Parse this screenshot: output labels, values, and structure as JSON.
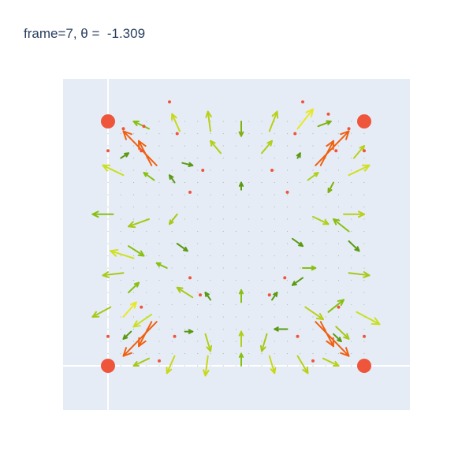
{
  "chart_data": {
    "type": "scatter",
    "title": "frame=7, θ =  -1.309",
    "xlabel": "",
    "ylabel": "",
    "xlim": [
      -0.2,
      1.3
    ],
    "ylim": [
      -0.2,
      1.3
    ],
    "grid": false,
    "zero_lines": true,
    "plot_bgcolor": "#E5ECF6",
    "colors": {
      "marker": "#EF553B",
      "title": "#2a3f5f"
    },
    "corner_markers": [
      {
        "x": 0,
        "y": 0
      },
      {
        "x": 1,
        "y": 0
      },
      {
        "x": 0,
        "y": 1
      },
      {
        "x": 1,
        "y": 1
      }
    ],
    "small_markers": [
      {
        "x": 0.24,
        "y": 1.08
      },
      {
        "x": 0.76,
        "y": 1.08
      },
      {
        "x": 0.27,
        "y": 0.95
      },
      {
        "x": 0.73,
        "y": 0.95
      },
      {
        "x": 0.13,
        "y": 0.88
      },
      {
        "x": 0.89,
        "y": 0.88
      },
      {
        "x": 0.37,
        "y": 0.8
      },
      {
        "x": 0.64,
        "y": 0.8
      },
      {
        "x": 0.32,
        "y": 0.71
      },
      {
        "x": 0.7,
        "y": 0.71
      },
      {
        "x": 0.32,
        "y": 0.36
      },
      {
        "x": 0.69,
        "y": 0.36
      },
      {
        "x": 0.36,
        "y": 0.29
      },
      {
        "x": 0.63,
        "y": 0.29
      },
      {
        "x": 0.13,
        "y": 0.24
      },
      {
        "x": 0.9,
        "y": 0.24
      },
      {
        "x": 0.26,
        "y": 0.12
      },
      {
        "x": 0.74,
        "y": 0.12
      },
      {
        "x": 0.0,
        "y": 0.12
      },
      {
        "x": 1.0,
        "y": 0.12
      },
      {
        "x": 0.0,
        "y": 0.88
      },
      {
        "x": 1.0,
        "y": 0.88
      },
      {
        "x": 0.06,
        "y": 0.97
      },
      {
        "x": 0.94,
        "y": 0.97
      },
      {
        "x": 0.2,
        "y": 0.02
      },
      {
        "x": 0.8,
        "y": 0.02
      },
      {
        "x": 0.14,
        "y": 0.98
      },
      {
        "x": 0.86,
        "y": 1.03
      }
    ],
    "arrows": [
      {
        "x": 0.19,
        "y": 0.82,
        "u": -0.13,
        "v": 0.14,
        "color": "#f06010"
      },
      {
        "x": 0.81,
        "y": 0.82,
        "u": 0.13,
        "v": 0.14,
        "color": "#f06010"
      },
      {
        "x": 0.19,
        "y": 0.18,
        "u": -0.13,
        "v": -0.14,
        "color": "#f06010"
      },
      {
        "x": 0.81,
        "y": 0.18,
        "u": 0.13,
        "v": -0.14,
        "color": "#f06010"
      },
      {
        "x": 0.17,
        "y": 0.82,
        "u": -0.05,
        "v": 0.1,
        "color": "#f06010"
      },
      {
        "x": 0.83,
        "y": 0.82,
        "u": 0.05,
        "v": 0.1,
        "color": "#f06010"
      },
      {
        "x": 0.17,
        "y": 0.18,
        "u": -0.05,
        "v": -0.1,
        "color": "#f06010"
      },
      {
        "x": 0.83,
        "y": 0.18,
        "u": 0.05,
        "v": -0.1,
        "color": "#f06010"
      },
      {
        "x": 0.16,
        "y": 0.97,
        "u": -0.06,
        "v": 0.03,
        "color": "#88c010"
      },
      {
        "x": 0.28,
        "y": 0.96,
        "u": -0.03,
        "v": 0.07,
        "color": "#c8d818"
      },
      {
        "x": 0.4,
        "y": 0.96,
        "u": -0.01,
        "v": 0.08,
        "color": "#b8d018"
      },
      {
        "x": 0.52,
        "y": 1.0,
        "u": 0.0,
        "v": -0.06,
        "color": "#80b010"
      },
      {
        "x": 0.63,
        "y": 0.96,
        "u": 0.03,
        "v": 0.08,
        "color": "#b8d018"
      },
      {
        "x": 0.74,
        "y": 0.97,
        "u": 0.06,
        "v": 0.08,
        "color": "#e8e820"
      },
      {
        "x": 0.82,
        "y": 0.98,
        "u": 0.05,
        "v": 0.02,
        "color": "#80b010"
      },
      {
        "x": 0.05,
        "y": 0.85,
        "u": 0.03,
        "v": 0.02,
        "color": "#5a9a10"
      },
      {
        "x": 0.29,
        "y": 0.83,
        "u": 0.04,
        "v": -0.01,
        "color": "#5a9a10"
      },
      {
        "x": 0.44,
        "y": 0.87,
        "u": -0.04,
        "v": 0.05,
        "color": "#b0d018"
      },
      {
        "x": 0.6,
        "y": 0.87,
        "u": 0.04,
        "v": 0.05,
        "color": "#b0d018"
      },
      {
        "x": 0.74,
        "y": 0.85,
        "u": 0.01,
        "v": 0.02,
        "color": "#5a9a10"
      },
      {
        "x": 0.96,
        "y": 0.85,
        "u": 0.04,
        "v": 0.05,
        "color": "#b8d018"
      },
      {
        "x": 0.06,
        "y": 0.78,
        "u": -0.08,
        "v": 0.04,
        "color": "#c8e020"
      },
      {
        "x": 0.18,
        "y": 0.76,
        "u": -0.04,
        "v": 0.03,
        "color": "#88c010"
      },
      {
        "x": 0.26,
        "y": 0.75,
        "u": -0.02,
        "v": 0.03,
        "color": "#5a9a10"
      },
      {
        "x": 0.52,
        "y": 0.72,
        "u": 0.0,
        "v": 0.03,
        "color": "#5a9a10"
      },
      {
        "x": 0.88,
        "y": 0.75,
        "u": -0.02,
        "v": -0.04,
        "color": "#80b010"
      },
      {
        "x": 0.78,
        "y": 0.76,
        "u": 0.04,
        "v": 0.03,
        "color": "#b0d018"
      },
      {
        "x": 0.94,
        "y": 0.78,
        "u": 0.08,
        "v": 0.04,
        "color": "#d0e020"
      },
      {
        "x": 0.02,
        "y": 0.62,
        "u": -0.08,
        "v": 0.0,
        "color": "#88c010"
      },
      {
        "x": 0.16,
        "y": 0.6,
        "u": -0.08,
        "v": -0.03,
        "color": "#a8c818"
      },
      {
        "x": 0.27,
        "y": 0.62,
        "u": -0.03,
        "v": -0.04,
        "color": "#a8c818"
      },
      {
        "x": 0.8,
        "y": 0.61,
        "u": 0.06,
        "v": -0.03,
        "color": "#b0d018"
      },
      {
        "x": 0.92,
        "y": 0.62,
        "u": 0.08,
        "v": 0.0,
        "color": "#b8d018"
      },
      {
        "x": 0.94,
        "y": 0.55,
        "u": -0.06,
        "v": 0.05,
        "color": "#88c010"
      },
      {
        "x": 0.08,
        "y": 0.49,
        "u": 0.06,
        "v": -0.04,
        "color": "#88c010"
      },
      {
        "x": 0.27,
        "y": 0.5,
        "u": 0.04,
        "v": -0.03,
        "color": "#5a9a10"
      },
      {
        "x": 0.72,
        "y": 0.52,
        "u": 0.04,
        "v": -0.03,
        "color": "#5a9a10"
      },
      {
        "x": 0.94,
        "y": 0.51,
        "u": 0.04,
        "v": -0.04,
        "color": "#5a9a10"
      },
      {
        "x": 0.1,
        "y": 0.44,
        "u": -0.09,
        "v": 0.03,
        "color": "#d0e020"
      },
      {
        "x": 0.23,
        "y": 0.4,
        "u": -0.04,
        "v": 0.02,
        "color": "#88c010"
      },
      {
        "x": 0.06,
        "y": 0.38,
        "u": -0.08,
        "v": -0.01,
        "color": "#a8c818"
      },
      {
        "x": 0.76,
        "y": 0.4,
        "u": 0.05,
        "v": 0.0,
        "color": "#88c010"
      },
      {
        "x": 0.94,
        "y": 0.38,
        "u": 0.08,
        "v": -0.01,
        "color": "#a8c818"
      },
      {
        "x": 0.76,
        "y": 0.36,
        "u": -0.04,
        "v": -0.03,
        "color": "#5a9a10"
      },
      {
        "x": 0.01,
        "y": 0.24,
        "u": -0.07,
        "v": -0.04,
        "color": "#a8c818"
      },
      {
        "x": 0.08,
        "y": 0.3,
        "u": 0.04,
        "v": 0.04,
        "color": "#88c010"
      },
      {
        "x": 0.17,
        "y": 0.21,
        "u": -0.07,
        "v": -0.05,
        "color": "#c8e020"
      },
      {
        "x": 0.33,
        "y": 0.28,
        "u": -0.06,
        "v": 0.04,
        "color": "#a8c818"
      },
      {
        "x": 0.4,
        "y": 0.27,
        "u": -0.02,
        "v": 0.03,
        "color": "#5a9a10"
      },
      {
        "x": 0.52,
        "y": 0.26,
        "u": 0.0,
        "v": 0.05,
        "color": "#88c010"
      },
      {
        "x": 0.64,
        "y": 0.27,
        "u": 0.02,
        "v": 0.03,
        "color": "#5a9a10"
      },
      {
        "x": 0.77,
        "y": 0.24,
        "u": 0.07,
        "v": -0.05,
        "color": "#b8d018"
      },
      {
        "x": 0.86,
        "y": 0.22,
        "u": 0.06,
        "v": 0.05,
        "color": "#88c010"
      },
      {
        "x": 0.97,
        "y": 0.22,
        "u": 0.09,
        "v": -0.05,
        "color": "#c8e020"
      },
      {
        "x": 0.06,
        "y": 0.2,
        "u": 0.05,
        "v": 0.06,
        "color": "#e8e820"
      },
      {
        "x": 0.89,
        "y": 0.16,
        "u": 0.05,
        "v": -0.05,
        "color": "#a8c818"
      },
      {
        "x": 0.09,
        "y": 0.14,
        "u": -0.03,
        "v": -0.03,
        "color": "#5a9a10"
      },
      {
        "x": 0.3,
        "y": 0.14,
        "u": 0.03,
        "v": 0.0,
        "color": "#5a9a10"
      },
      {
        "x": 0.38,
        "y": 0.13,
        "u": 0.02,
        "v": -0.07,
        "color": "#b0d018"
      },
      {
        "x": 0.52,
        "y": 0.08,
        "u": 0.0,
        "v": 0.06,
        "color": "#b0d018"
      },
      {
        "x": 0.62,
        "y": 0.13,
        "u": -0.02,
        "v": -0.07,
        "color": "#a8c818"
      },
      {
        "x": 0.7,
        "y": 0.15,
        "u": -0.05,
        "v": 0.0,
        "color": "#5a9a10"
      },
      {
        "x": 0.88,
        "y": 0.13,
        "u": 0.03,
        "v": -0.03,
        "color": "#5a9a10"
      },
      {
        "x": 0.16,
        "y": 0.03,
        "u": -0.06,
        "v": -0.03,
        "color": "#a8c818"
      },
      {
        "x": 0.26,
        "y": 0.04,
        "u": -0.03,
        "v": -0.07,
        "color": "#c8d818"
      },
      {
        "x": 0.39,
        "y": 0.04,
        "u": -0.01,
        "v": -0.08,
        "color": "#c8d818"
      },
      {
        "x": 0.52,
        "y": 0.0,
        "u": 0.0,
        "v": 0.05,
        "color": "#88c010"
      },
      {
        "x": 0.63,
        "y": 0.04,
        "u": 0.02,
        "v": -0.07,
        "color": "#c8d818"
      },
      {
        "x": 0.74,
        "y": 0.04,
        "u": 0.04,
        "v": -0.07,
        "color": "#b8d018"
      },
      {
        "x": 0.84,
        "y": 0.03,
        "u": 0.06,
        "v": -0.03,
        "color": "#b8d018"
      }
    ]
  }
}
